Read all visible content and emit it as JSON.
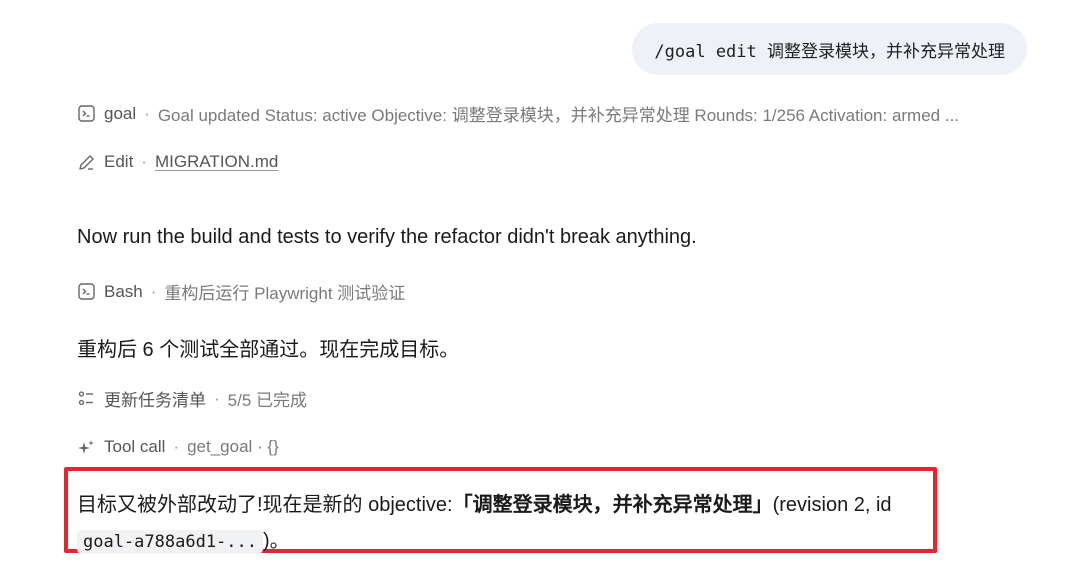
{
  "user_message": "/goal edit 调整登录模块，并补充异常处理",
  "steps": {
    "goal": {
      "icon": "terminal-icon",
      "name": "goal",
      "separator": "·",
      "detail": "Goal updated Status: active Objective: 调整登录模块，并补充异常处理 Rounds: 1/256 Activation: armed ..."
    },
    "edit": {
      "icon": "pencil-icon",
      "name": "Edit",
      "separator": "·",
      "file": "MIGRATION.md"
    },
    "bash": {
      "icon": "terminal-icon",
      "name": "Bash",
      "separator": "·",
      "detail": "重构后运行 Playwright 测试验证"
    },
    "tasks": {
      "icon": "checklist-icon",
      "name": "更新任务清单",
      "separator": "·",
      "detail": "5/5 已完成"
    },
    "toolcall": {
      "icon": "sparkle-icon",
      "name": "Tool call",
      "separator": "·",
      "detail": "get_goal · {}"
    }
  },
  "messages": {
    "run_build": "Now run the build and tests to verify the refactor didn't break anything.",
    "tests_passed": "重构后 6 个测试全部通过。现在完成目标。"
  },
  "final": {
    "prefix": "目标又被外部改动了!现在是新的 objective:",
    "objective": "「调整登录模块，并补充异常处理」",
    "suffix": "(revision 2, id",
    "goal_id": "goal-a788a6d1-...",
    "end": ")。"
  },
  "colors": {
    "highlight_border": "#e32630",
    "bubble_bg": "#eef1f7"
  }
}
